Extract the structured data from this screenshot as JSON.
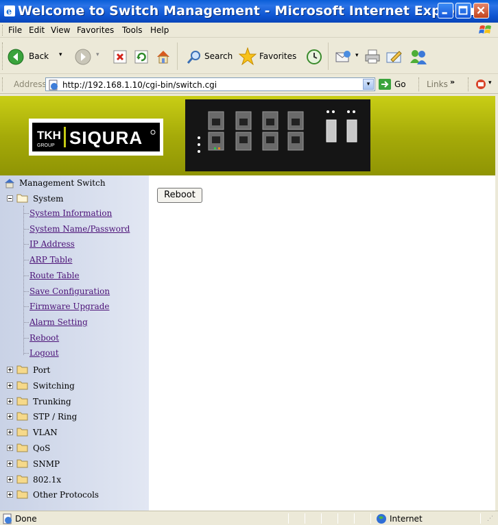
{
  "window": {
    "title": "Welcome to Switch Management - Microsoft Internet Explorer"
  },
  "menubar": {
    "items": [
      "File",
      "Edit",
      "View",
      "Favorites",
      "Tools",
      "Help"
    ]
  },
  "toolbar": {
    "back_label": "Back",
    "search_label": "Search",
    "favorites_label": "Favorites"
  },
  "addressbar": {
    "label": "Address",
    "url": "http://192.168.1.10/cgi-bin/switch.cgi",
    "go_label": "Go",
    "links_label": "Links"
  },
  "banner": {
    "logo_text": "SIQURA",
    "logo_mark": "TKH GROUP"
  },
  "tree": {
    "root_label": "Management Switch",
    "system_label": "System",
    "system_items": [
      "System Information",
      "System Name/Password",
      "IP Address",
      "ARP Table",
      "Route Table",
      "Save Configuration",
      "Firmware Upgrade",
      "Alarm Setting",
      "Reboot",
      "Logout"
    ],
    "folders": [
      "Port",
      "Switching",
      "Trunking",
      "STP / Ring",
      "VLAN",
      "QoS",
      "SNMP",
      "802.1x",
      "Other Protocols"
    ]
  },
  "content": {
    "reboot_button": "Reboot"
  },
  "statusbar": {
    "status": "Done",
    "zone": "Internet"
  },
  "colors": {
    "titlebar": "#0a5fd8",
    "banner": "#a6ab09",
    "link_visited": "#4b1177"
  }
}
